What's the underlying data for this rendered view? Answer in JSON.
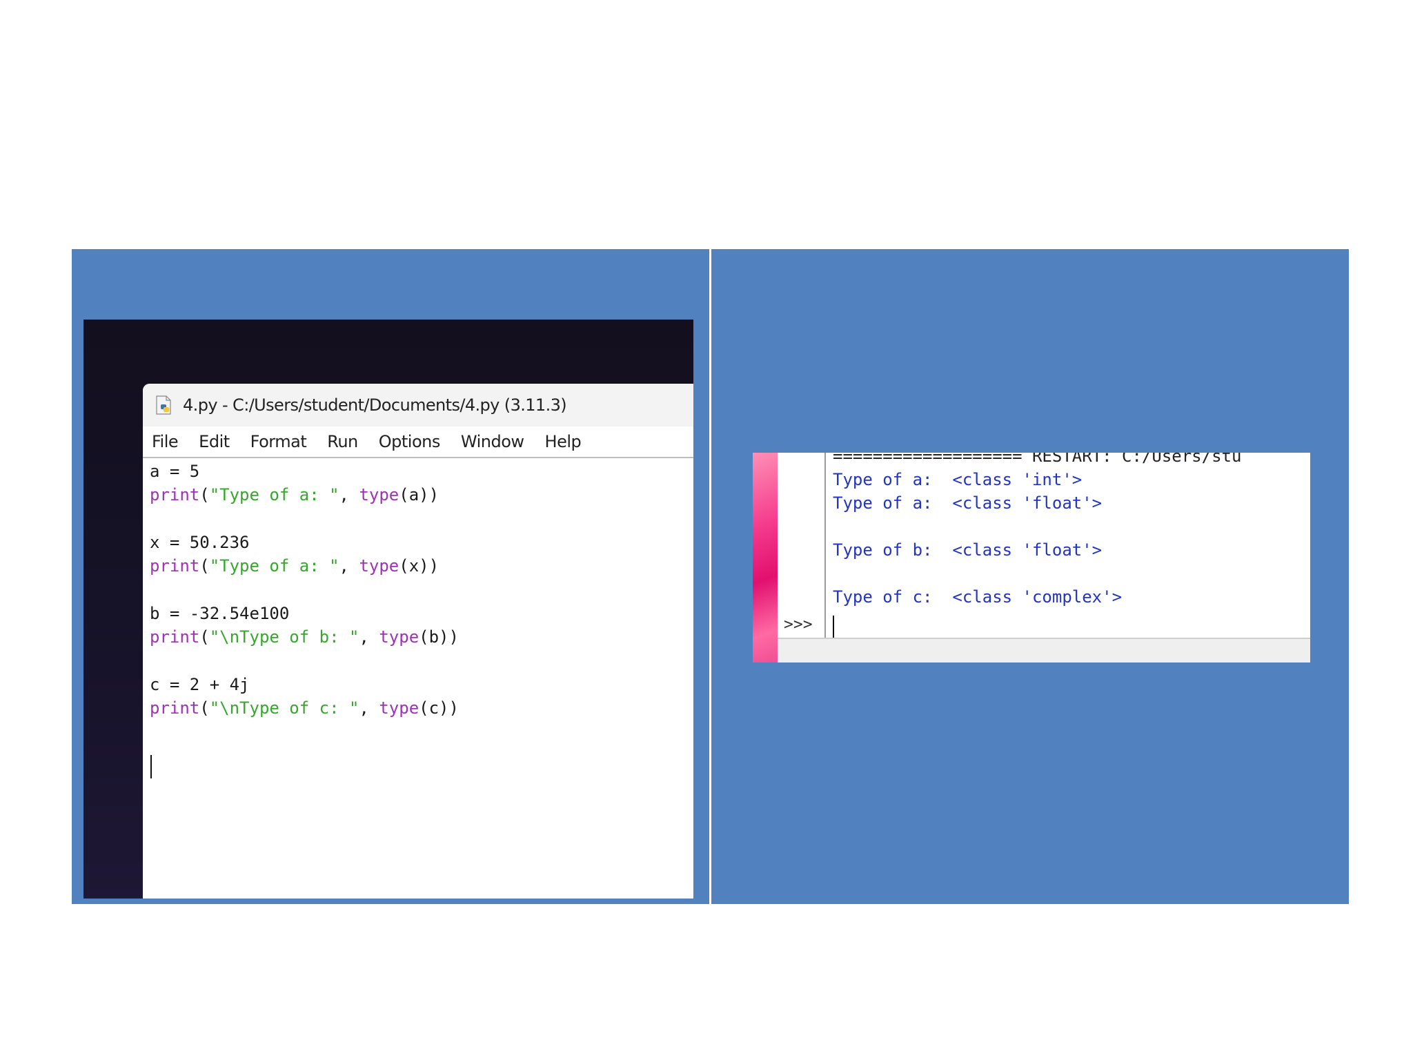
{
  "editor": {
    "title": "4.py - C:/Users/student/Documents/4.py (3.11.3)",
    "menu": [
      "File",
      "Edit",
      "Format",
      "Run",
      "Options",
      "Window",
      "Help"
    ],
    "code": {
      "l1": "a = 5",
      "l2_fn": "print",
      "l2_open": "(",
      "l2_str": "\"Type of a: \"",
      "l2_comma": ", ",
      "l2_type": "type",
      "l2_arg": "(a))",
      "l4": "x = 50.236",
      "l5_fn": "print",
      "l5_open": "(",
      "l5_str": "\"Type of a: \"",
      "l5_comma": ", ",
      "l5_type": "type",
      "l5_arg": "(x))",
      "l7": "b = -32.54e100",
      "l8_fn": "print",
      "l8_open": "(",
      "l8_str": "\"\\nType of b: \"",
      "l8_comma": ", ",
      "l8_type": "type",
      "l8_arg": "(b))",
      "l10": "c = 2 + 4j",
      "l11_fn": "print",
      "l11_open": "(",
      "l11_str": "\"\\nType of c: \"",
      "l11_comma": ", ",
      "l11_type": "type",
      "l11_arg": "(c))"
    }
  },
  "shell": {
    "restart": "=================== RESTART: C:/Users/stu",
    "out1": "Type of a:  <class 'int'>",
    "out2": "Type of a:  <class 'float'>",
    "out3": "Type of b:  <class 'float'>",
    "out4": "Type of c:  <class 'complex'>",
    "prompt": ">>>"
  },
  "colors": {
    "panel": "#5181bf",
    "keyword": "#a031b6",
    "string": "#35a82c",
    "shell_output": "#2134c6"
  }
}
